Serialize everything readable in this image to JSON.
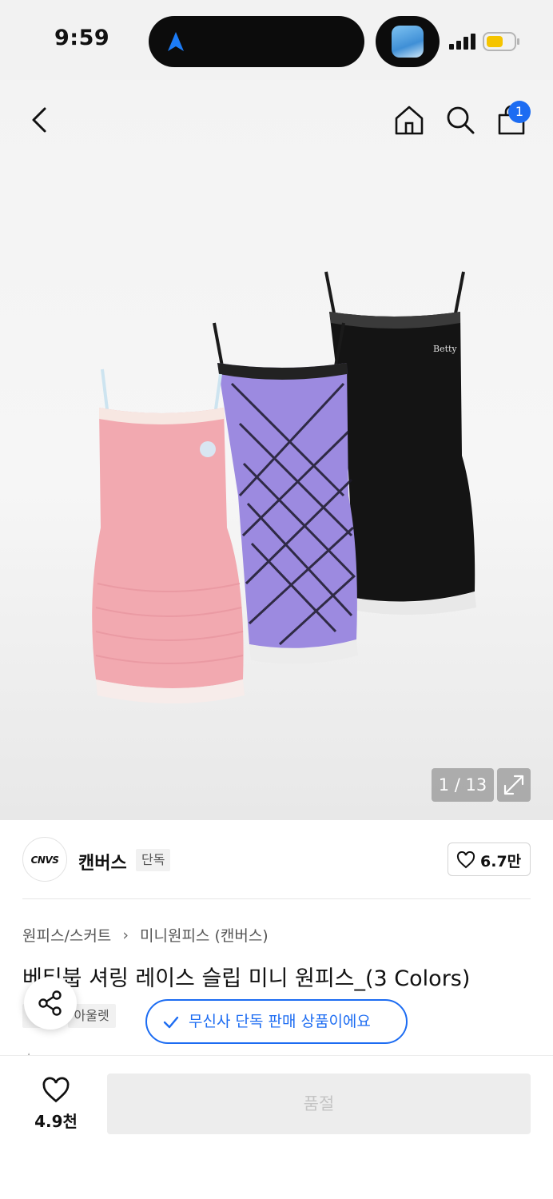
{
  "status_bar": {
    "time": "9:59"
  },
  "header": {
    "cart_count": "1"
  },
  "gallery": {
    "page_indicator": "1 / 13"
  },
  "brand": {
    "logo_text": "CNVS",
    "name": "캔버스",
    "tag": "단독",
    "likes": "6.7만"
  },
  "category": {
    "level1": "원피스/스커트",
    "level2": "미니원피스 (캔버스)"
  },
  "product": {
    "title": "베티붑 셔링 레이스 슬립 미니 원피스_(3 Colors)",
    "tags": [
      "단독",
      "아울렛"
    ]
  },
  "toast": {
    "text": "무신사 단독 판매 상품이에요"
  },
  "bottom_bar": {
    "wish_count": "4.9천",
    "buy_label": "품절"
  },
  "colors": {
    "accent": "#1c6cf2",
    "soldout_bg": "#ededed",
    "soldout_text": "#c4c4c4"
  },
  "icons": [
    "back-icon",
    "home-icon",
    "search-icon",
    "cart-icon",
    "expand-icon",
    "heart-icon",
    "share-icon",
    "check-icon"
  ]
}
